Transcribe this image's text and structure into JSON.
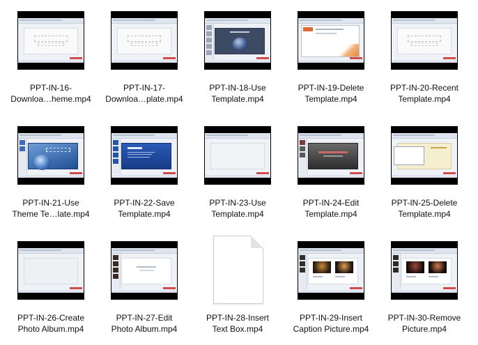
{
  "files": [
    {
      "line1": "PPT-IN-16-",
      "line2": "Downloa…heme.mp4",
      "thumb": "plain-title",
      "icon": "video-thumbnail-icon"
    },
    {
      "line1": "PPT-IN-17-",
      "line2": "Downloa…plate.mp4",
      "thumb": "plain-title",
      "icon": "video-thumbnail-icon"
    },
    {
      "line1": "PPT-IN-18-Use",
      "line2": "Template.mp4",
      "thumb": "globe-dark",
      "icon": "video-thumbnail-icon"
    },
    {
      "line1": "PPT-IN-19-Delete",
      "line2": "Template.mp4",
      "thumb": "dialog",
      "icon": "video-thumbnail-icon"
    },
    {
      "line1": "PPT-IN-20-Recent",
      "line2": "Template.mp4",
      "thumb": "plain-title",
      "icon": "video-thumbnail-icon"
    },
    {
      "line1": "PPT-IN-21-Use",
      "line2": "Theme Te…late.mp4",
      "thumb": "globe-blue",
      "icon": "video-thumbnail-icon"
    },
    {
      "line1": "PPT-IN-22-Save",
      "line2": "Template.mp4",
      "thumb": "blue-slides",
      "icon": "video-thumbnail-icon"
    },
    {
      "line1": "PPT-IN-23-Use",
      "line2": "Template.mp4",
      "thumb": "blank",
      "icon": "video-thumbnail-icon"
    },
    {
      "line1": "PPT-IN-24-Edit",
      "line2": "Template.mp4",
      "thumb": "dark-slide",
      "icon": "video-thumbnail-icon"
    },
    {
      "line1": "PPT-IN-25-Delete",
      "line2": "Template.mp4",
      "thumb": "cream-dialog",
      "icon": "video-thumbnail-icon"
    },
    {
      "line1": "PPT-IN-26-Create",
      "line2": "Photo Album.mp4",
      "thumb": "blank",
      "icon": "video-thumbnail-icon"
    },
    {
      "line1": "PPT-IN-27-Edit",
      "line2": "Photo Album.mp4",
      "thumb": "album",
      "icon": "video-thumbnail-icon"
    },
    {
      "line1": "PPT-IN-28-Insert",
      "line2": "Text Box.mp4",
      "thumb": "document",
      "icon": "generic-document-icon"
    },
    {
      "line1": "PPT-IN-29-Insert",
      "line2": "Caption Picture.mp4",
      "thumb": "photos",
      "icon": "video-thumbnail-icon"
    },
    {
      "line1": "PPT-IN-30-Remove",
      "line2": "Picture.mp4",
      "thumb": "photos-dark",
      "icon": "video-thumbnail-icon"
    }
  ]
}
